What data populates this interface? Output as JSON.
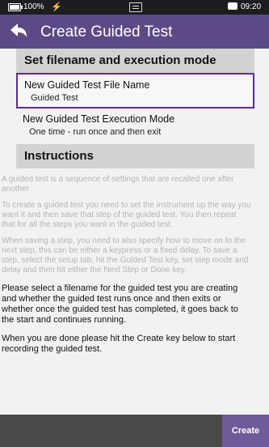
{
  "status_bar": {
    "battery": "100%",
    "time": "09:20"
  },
  "header": {
    "title": "Create Guided Test"
  },
  "sections": {
    "filename_mode_heading": "Set filename and execution mode",
    "instructions_heading": "Instructions"
  },
  "file_name": {
    "label": "New Guided Test File Name",
    "value": "Guided Test"
  },
  "execution_mode": {
    "label": "New Guided Test Execution Mode",
    "value": "One time - run once and then exit"
  },
  "instructions": {
    "p1": "A guided test is a sequence of settings that are recalled one after another",
    "p2": "To create a guided test you need to set the instrument up the way you want it and then save that step of the guided test. You then repeat that for all the steps you want in the guided test.",
    "p3": "When saving a step, you need to also specify how to move on to the next step, this can be either a keypress or a fixed delay. To save a step, select the setup tab, hit the Guided Test key, set step mode and delay and then hit either the Next Step or Done key.",
    "p4": "Please select a filename for the guided test you are creating and whether the guided test runs once and then exits or whether once the guided test has completed, it goes back to the start and continues running.",
    "p5": "When you are done please hit the Create key below to start recording the guided test."
  },
  "footer": {
    "create_label": "Create"
  },
  "colors": {
    "header_bg": "#5c4a86",
    "selection_border": "#5c2d91",
    "create_button_bg": "#6f5b97"
  }
}
